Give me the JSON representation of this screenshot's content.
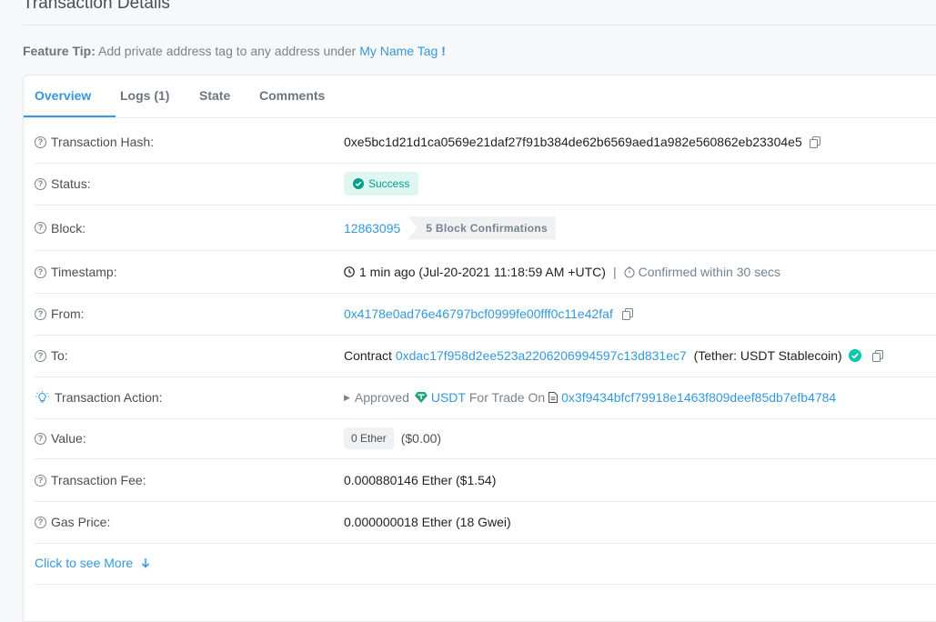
{
  "page": {
    "title": "Transaction Details"
  },
  "feature_tip": {
    "label": "Feature Tip:",
    "text": "Add private address tag to any address under",
    "link": "My Name Tag",
    "bang": "!"
  },
  "tabs": [
    {
      "label": "Overview",
      "active": true
    },
    {
      "label": "Logs (1)",
      "active": false
    },
    {
      "label": "State",
      "active": false
    },
    {
      "label": "Comments",
      "active": false
    }
  ],
  "rows": {
    "hash": {
      "label": "Transaction Hash:",
      "value": "0xe5bc1d21d1ca0569e21daf27f91b384de62b6569aed1a982e560862eb23304e5"
    },
    "status": {
      "label": "Status:",
      "value": "Success"
    },
    "block": {
      "label": "Block:",
      "number": "12863095",
      "confirmations": "5 Block Confirmations"
    },
    "timestamp": {
      "label": "Timestamp:",
      "value": "1 min ago (Jul-20-2021 11:18:59 AM +UTC)",
      "separator": "|",
      "confirmed": "Confirmed within 30 secs"
    },
    "from": {
      "label": "From:",
      "value": "0x4178e0ad76e46797bcf0999fe00fff0c11e42faf"
    },
    "to": {
      "label": "To:",
      "prefix": "Contract",
      "address": "0xdac17f958d2ee523a2206206994597c13d831ec7",
      "name": "(Tether: USDT Stablecoin)"
    },
    "action": {
      "label": "Transaction Action:",
      "verb": "Approved",
      "token": "USDT",
      "mid": "For Trade On",
      "address": "0x3f9434bfcf79918e1463f809deef85db7efb4784"
    },
    "value": {
      "label": "Value:",
      "amount": "0 Ether",
      "usd": "($0.00)"
    },
    "fee": {
      "label": "Transaction Fee:",
      "value": "0.000880146 Ether ($1.54)"
    },
    "gas": {
      "label": "Gas Price:",
      "value": "0.000000018 Ether (18 Gwei)"
    }
  },
  "see_more": "Click to see More",
  "colors": {
    "accent": "#3498db",
    "success": "#00a186",
    "success_bg": "#def7f2",
    "token": "#26a17b"
  }
}
